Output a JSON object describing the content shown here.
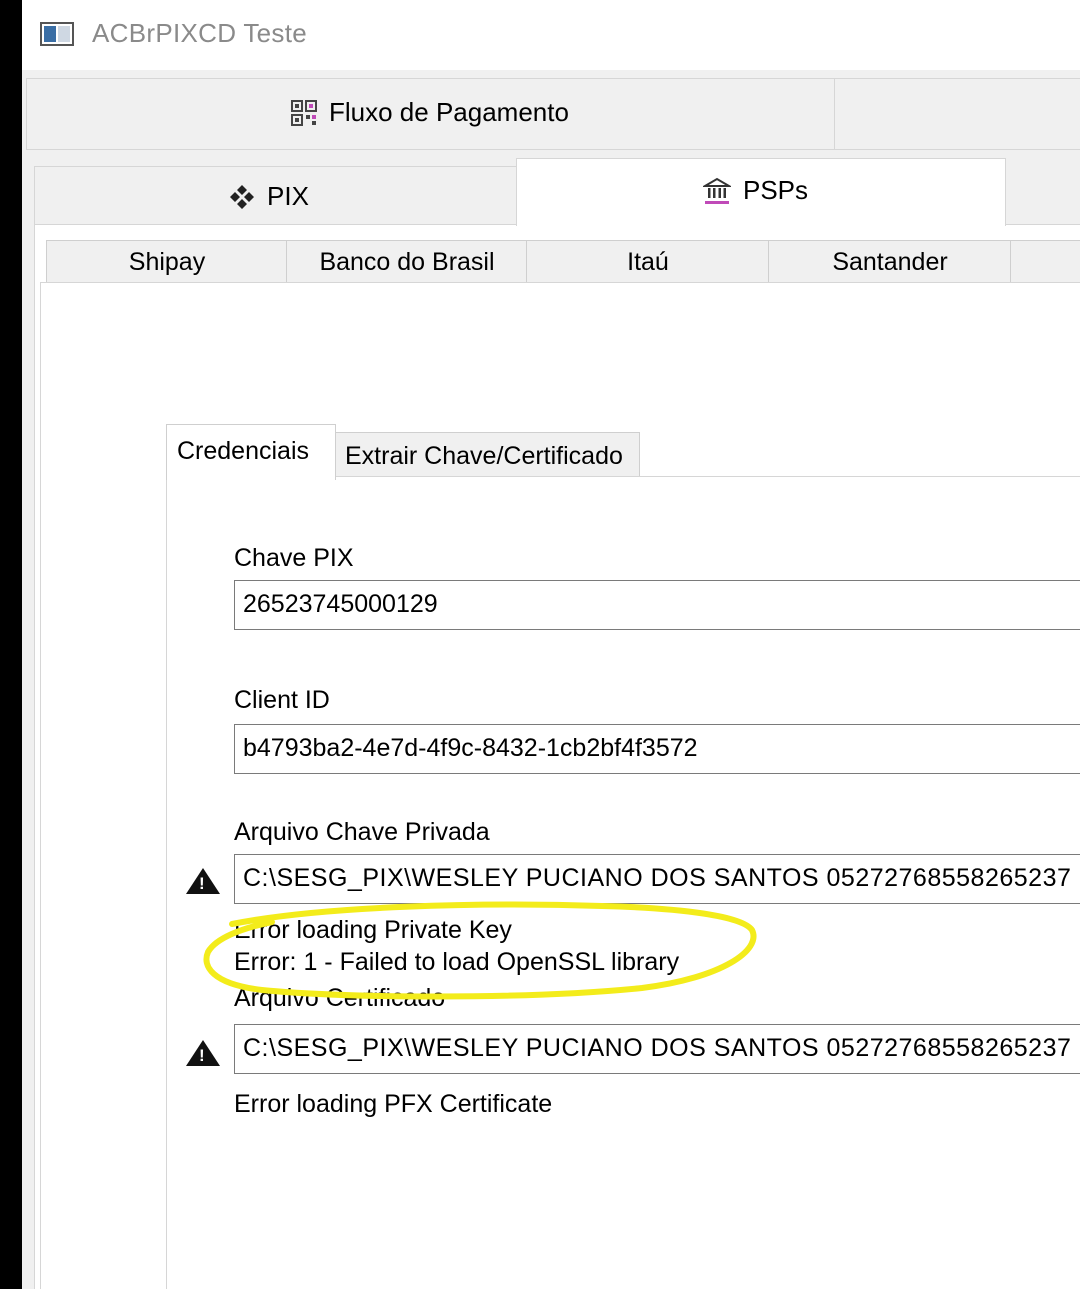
{
  "window": {
    "title": "ACBrPIXCD Teste"
  },
  "main_tabs": [
    {
      "label": "Fluxo de Pagamento",
      "icon": "qr-code-icon"
    },
    {
      "label": ""
    }
  ],
  "sub_tabs": [
    {
      "label": "PIX",
      "icon": "pix-diamond-icon"
    },
    {
      "label": "PSPs",
      "icon": "bank-icon",
      "active": true
    }
  ],
  "psp_tabs": [
    "Shipay",
    "Banco do Brasil",
    "Itaú",
    "Santander"
  ],
  "cred_tabs": [
    {
      "label": "Credenciais",
      "active": true
    },
    {
      "label": "Extrair Chave/Certificado"
    }
  ],
  "form": {
    "chave_pix": {
      "label": "Chave PIX",
      "value": "26523745000129"
    },
    "client_id": {
      "label": "Client ID",
      "value": "b4793ba2-4e7d-4f9c-8432-1cb2bf4f3572"
    },
    "chave_privada": {
      "label": "Arquivo Chave Privada",
      "value": "C:\\SESG_PIX\\WESLEY PUCIANO DOS SANTOS 05272768558265237",
      "error_line1": "Error loading Private Key",
      "error_line2": "Error: 1 - Failed to load OpenSSL library"
    },
    "certificado": {
      "label": "Arquivo Certificado",
      "value": "C:\\SESG_PIX\\WESLEY PUCIANO DOS SANTOS 05272768558265237",
      "error_line1": "Error loading PFX Certificate"
    }
  },
  "annotation_color": "#f3ec1b",
  "icons": [
    "app-icon",
    "qr-code-icon",
    "pix-diamond-icon",
    "bank-icon",
    "warning-icon"
  ]
}
